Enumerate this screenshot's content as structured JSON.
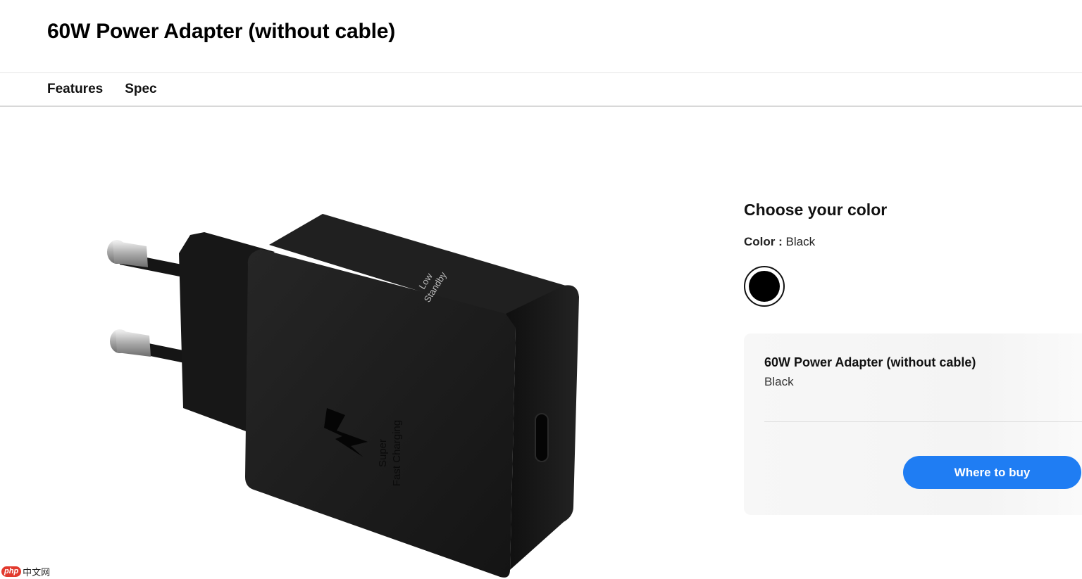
{
  "header": {
    "title": "60W Power Adapter (without cable)"
  },
  "tabs": [
    {
      "label": "Features"
    },
    {
      "label": "Spec"
    }
  ],
  "product_image": {
    "printed_text": [
      "Low",
      "Standby",
      "Super",
      "Fast Charging"
    ],
    "icon": "lightning-icon"
  },
  "color_selector": {
    "heading": "Choose your color",
    "label": "Color :",
    "selected_value": "Black",
    "swatches": [
      {
        "color": "#000000"
      }
    ]
  },
  "summary": {
    "product_name": "60W Power Adapter (without cable)",
    "color": "Black",
    "buy_button_label": "Where to buy"
  },
  "watermark": {
    "logo": "php",
    "text": "中文网"
  },
  "colors": {
    "accent": "#1f7df3",
    "product": "#1b1b1b"
  }
}
